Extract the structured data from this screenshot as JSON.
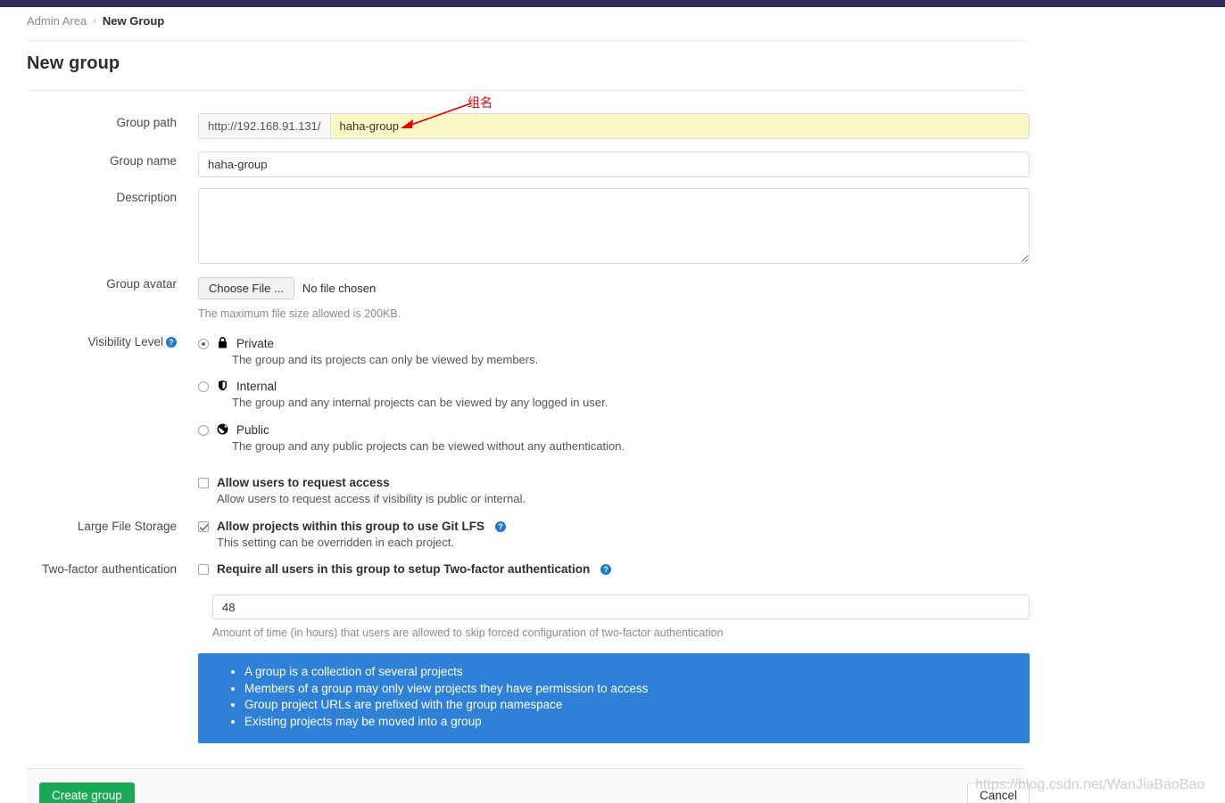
{
  "breadcrumb": {
    "parent": "Admin Area",
    "separator": "›",
    "current": "New Group"
  },
  "page_title": "New group",
  "form": {
    "group_path": {
      "label": "Group path",
      "prefix": "http://192.168.91.131/",
      "value": "haha-group",
      "placeholder": ""
    },
    "group_name": {
      "label": "Group name",
      "value": "haha-group",
      "placeholder": ""
    },
    "description": {
      "label": "Description",
      "value": "",
      "placeholder": ""
    },
    "group_avatar": {
      "label": "Group avatar",
      "choose_button": "Choose File ...",
      "no_file_text": "No file chosen",
      "hint": "The maximum file size allowed is 200KB."
    },
    "visibility": {
      "label": "Visibility Level",
      "help_icon": "question-circle-icon",
      "selected": "private",
      "options": [
        {
          "id": "private",
          "icon": "lock-icon",
          "glyph": "🔒",
          "name": "Private",
          "description": "The group and its projects can only be viewed by members.",
          "checked": true
        },
        {
          "id": "internal",
          "icon": "shield-icon",
          "glyph": "🛡",
          "name": "Internal",
          "description": "The group and any internal projects can be viewed by any logged in user.",
          "checked": false
        },
        {
          "id": "public",
          "icon": "globe-icon",
          "glyph": "🌎",
          "name": "Public",
          "description": "The group and any public projects can be viewed without any authentication.",
          "checked": false
        }
      ]
    },
    "request_access": {
      "label": "",
      "title": "Allow users to request access",
      "description": "Allow users to request access if visibility is public or internal.",
      "checked": false
    },
    "lfs": {
      "label": "Large File Storage",
      "title": "Allow projects within this group to use Git LFS",
      "help_icon": "question-circle-icon",
      "description": "This setting can be overridden in each project.",
      "checked": true
    },
    "two_factor": {
      "label": "Two-factor authentication",
      "title": "Require all users in this group to setup Two-factor authentication",
      "help_icon": "question-circle-icon",
      "checked": false,
      "grace_period_value": "48",
      "grace_period_hint": "Amount of time (in hours) that users are allowed to skip forced configuration of two-factor authentication"
    }
  },
  "info_panel": {
    "bullets": [
      "A group is a collection of several projects",
      "Members of a group may only view projects they have permission to access",
      "Group project URLs are prefixed with the group namespace",
      "Existing projects may be moved into a group"
    ],
    "background_color": "#2e81d6"
  },
  "footer": {
    "create_label": "Create group",
    "cancel_label": "Cancel",
    "create_color": "#1aaa55"
  },
  "annotation": {
    "text": "组名",
    "color": "#e60000"
  },
  "watermark": "https://blog.csdn.net/WanJiaBaoBao",
  "colors": {
    "navbar": "#2e2a5b",
    "highlight_input": "#f8f8c5",
    "help_icon": "#1f78d1"
  }
}
